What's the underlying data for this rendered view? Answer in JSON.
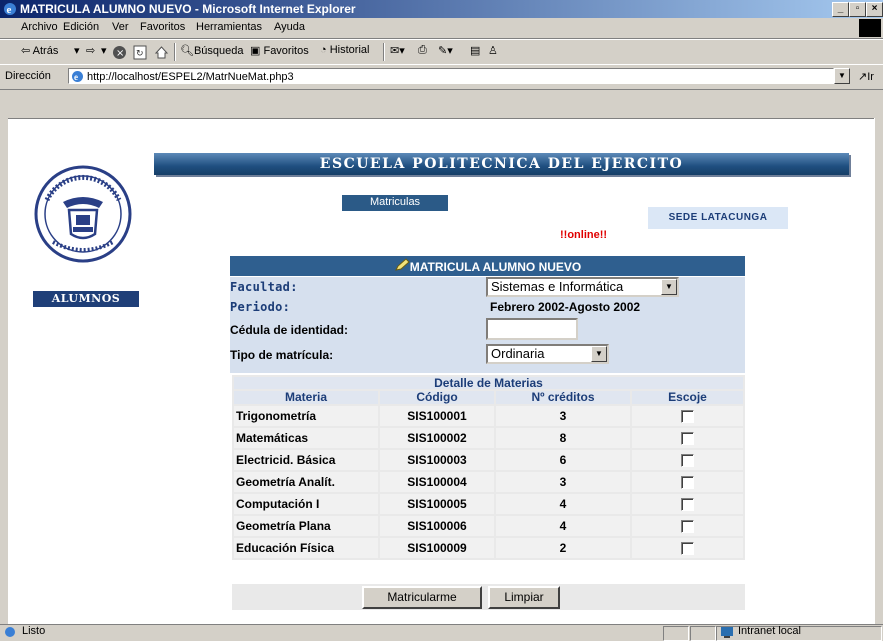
{
  "window": {
    "title": "MATRICULA ALUMNO NUEVO - Microsoft Internet Explorer",
    "controls": {
      "minimize": "_",
      "restore": "̈",
      "close": "×"
    }
  },
  "menu": {
    "items": [
      "Archivo",
      "Edición",
      "Ver",
      "Favoritos",
      "Herramientas",
      "Ayuda"
    ]
  },
  "toolbar": {
    "back": "⇦ Atrás",
    "forward": "⇨",
    "search": "Búsqueda",
    "favorites": "Favoritos",
    "history": "Historial"
  },
  "address": {
    "label": "Dirección",
    "url": "http://localhost/ESPEL2/MatrNueMat.php3",
    "go": "↗Ir"
  },
  "page": {
    "banner": "ESCUELA POLITECNICA DEL EJERCITO",
    "matriculas_button": "Matriculas",
    "sede": "SEDE LATACUNGA",
    "online": "!!online!!",
    "alumnos": "ALUMNOS",
    "form_title": "MATRICULA ALUMNO NUEVO",
    "facultad_label": "Facultad:",
    "facultad_value": "Sistemas e Informática",
    "periodo_label": "Periodo:",
    "periodo_value": "Febrero 2002-Agosto 2002",
    "cedula_label": "Cédula de identidad:",
    "tipo_label": "Tipo de matrícula:",
    "tipo_value": "Ordinaria"
  },
  "details": {
    "caption": "Detalle de Materias",
    "headers": [
      "Materia",
      "Código",
      "Nº créditos",
      "Escoje"
    ],
    "rows": [
      {
        "materia": "Trigonometría",
        "codigo": "SIS100001",
        "creditos": "3"
      },
      {
        "materia": "Matemáticas",
        "codigo": "SIS100002",
        "creditos": "8"
      },
      {
        "materia": "Electricid. Básica",
        "codigo": "SIS100003",
        "creditos": "6"
      },
      {
        "materia": "Geometría Analít.",
        "codigo": "SIS100004",
        "creditos": "3"
      },
      {
        "materia": "Computación I",
        "codigo": "SIS100005",
        "creditos": "4"
      },
      {
        "materia": "Geometría Plana",
        "codigo": "SIS100006",
        "creditos": "4"
      },
      {
        "materia": "Educación Física",
        "codigo": "SIS100009",
        "creditos": "2"
      }
    ]
  },
  "buttons": {
    "submit": "Matricularme",
    "clear": "Limpiar"
  },
  "status": {
    "text": "Listo",
    "zone": "Intranet local"
  }
}
